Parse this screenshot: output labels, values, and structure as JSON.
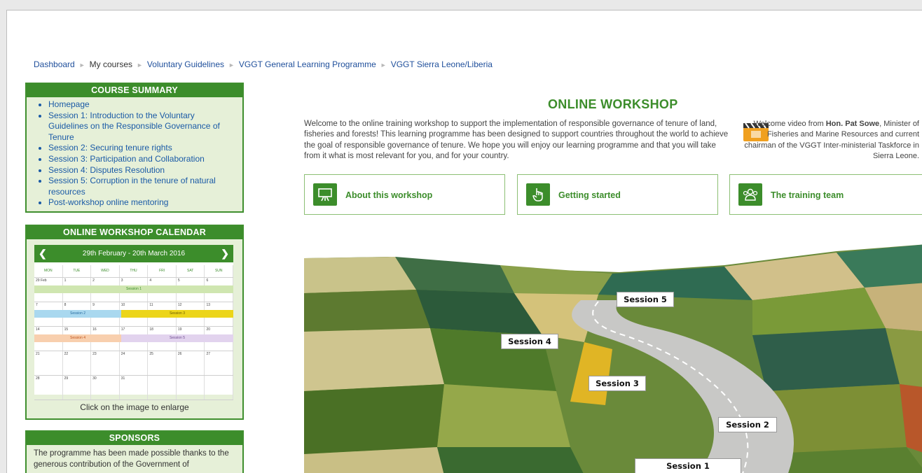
{
  "breadcrumb": {
    "items": [
      "Dashboard",
      "My courses",
      "Voluntary Guidelines",
      "VGGT General Learning Programme"
    ],
    "current": "VGGT Sierra Leone/Liberia"
  },
  "course_summary": {
    "title": "COURSE SUMMARY",
    "items": [
      "Homepage",
      "Session 1: Introduction to the Voluntary Guidelines on the Responsible Governance of Tenure",
      "Session 2: Securing tenure rights",
      "Session 3: Participation and Collaboration",
      "Session 4: Disputes Resolution",
      "Session 5: Corruption in the tenure of natural resources",
      "Post-workshop online mentoring"
    ]
  },
  "calendar": {
    "title": "ONLINE WORKSHOP CALENDAR",
    "range": "29th February - 20th March 2016",
    "days": [
      "MON",
      "TUE",
      "WED",
      "THU",
      "FRI",
      "SAT",
      "SUN"
    ],
    "weeks": [
      [
        "29 Feb",
        "1",
        "2",
        "3",
        "4",
        "5",
        "6"
      ],
      [
        "7",
        "8",
        "9",
        "10",
        "11",
        "12",
        "13"
      ],
      [
        "14",
        "15",
        "16",
        "17",
        "18",
        "19",
        "20"
      ],
      [
        "21",
        "22",
        "23",
        "24",
        "25",
        "26",
        "27"
      ],
      [
        "28",
        "29",
        "30",
        "31",
        "",
        "",
        ""
      ]
    ],
    "bars": [
      "Session 1",
      "Session 2",
      "Session 3",
      "Session 4",
      "Session 5"
    ],
    "caption": "Click on the image to enlarge"
  },
  "sponsors": {
    "title": "SPONSORS",
    "text": "The programme has been made possible thanks to the generous contribution of the Government of"
  },
  "main": {
    "title": "ONLINE WORKSHOP",
    "welcome": "Welcome to the online training workshop to support the implementation of responsible governance of tenure of land, fisheries and forests! This learning programme has been designed to support countries throughout the world to achieve the goal of responsible governance of tenure. We hope you will enjoy our learning programme and that you will take from it what is most relevant for you, and for your country.",
    "video_prefix": "Welcome video from ",
    "video_name": "Hon. Pat Sowe",
    "video_suffix": ", Minister of Fisheries and Marine Resources and current chairman of the VGGT Inter-ministerial Taskforce in Sierra Leone.",
    "buttons": [
      "About this workshop",
      "Getting started",
      "The training team"
    ],
    "sessions": [
      "Session 5",
      "Session 4",
      "Session 3",
      "Session 2",
      "Session 1"
    ]
  },
  "colors": {
    "accent_green": "#3c8d2b",
    "block_bg": "#e6f0d8",
    "link_blue": "#1a5aa6"
  }
}
